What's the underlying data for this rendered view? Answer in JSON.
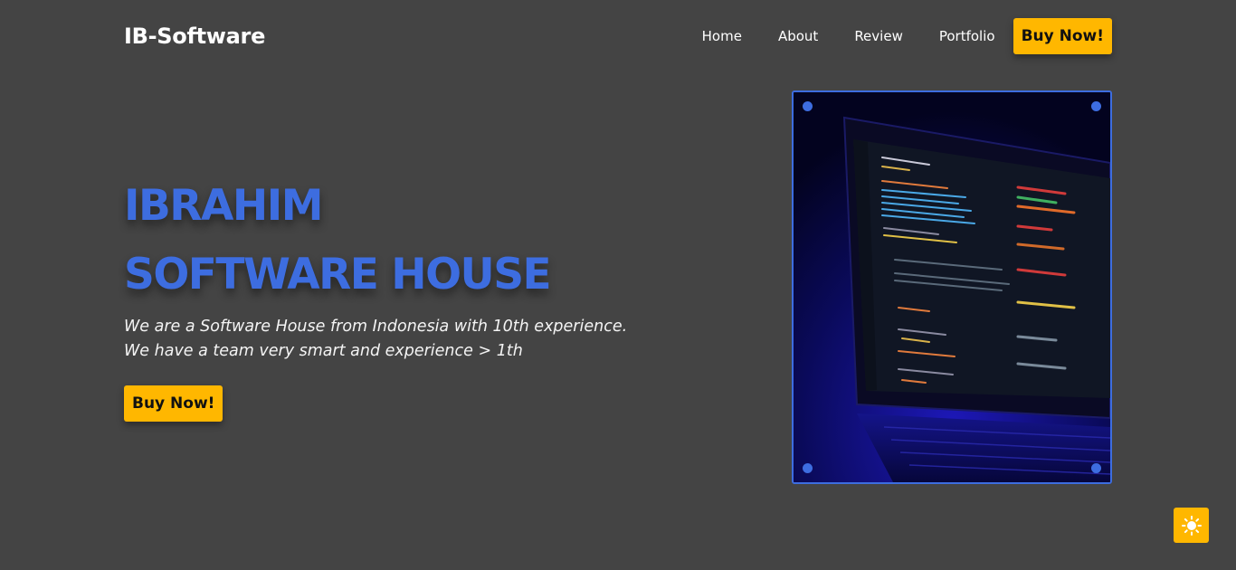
{
  "navbar": {
    "brand": "IB-Software",
    "links": [
      "Home",
      "About",
      "Review",
      "Portfolio"
    ],
    "buy_label": "Buy Now!"
  },
  "hero": {
    "title_line1": "IBRAHIM",
    "title_line2": "SOFTWARE HOUSE",
    "text_line1": "We are a Software House from Indonesia with 10th experience.",
    "text_line2": "We have a team very smart and experience > 1th",
    "buy_label": "Buy Now!"
  },
  "theme_toggle": {
    "icon": "sun-icon"
  },
  "colors": {
    "background": "#444444",
    "accent_blue": "#3d6de0",
    "accent_yellow": "#ffb700",
    "text": "#ffffff"
  }
}
